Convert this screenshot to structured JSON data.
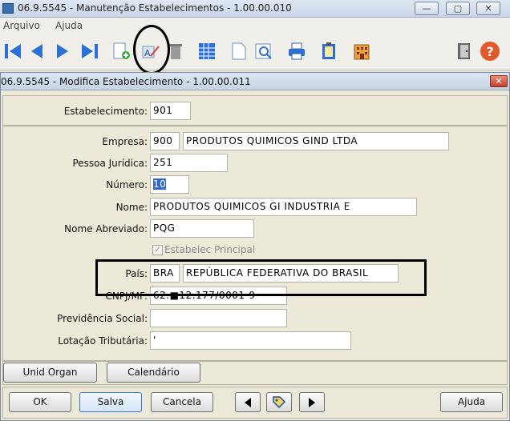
{
  "main_window": {
    "title": "06.9.5545 - Manutenção Estabelecimentos - 1.00.00.010",
    "btn_min": "—",
    "btn_max": "▢",
    "btn_close": "✕"
  },
  "menu": {
    "items": [
      "Arquivo",
      "Ajuda"
    ]
  },
  "toolbar": {
    "icons": [
      "first-icon",
      "previous-icon",
      "next-icon",
      "last-icon",
      "new-icon",
      "edit-icon",
      "delete-icon",
      "calendar-grid-icon",
      "document-icon",
      "preview-icon",
      "print-icon",
      "clipboard-icon",
      "building-icon",
      "exit-door-icon",
      "help-icon"
    ]
  },
  "dialog": {
    "title": "06.9.5545 - Modifica Estabelecimento - 1.00.00.011",
    "close_label": "✕",
    "fields": {
      "estabelecimento": {
        "label": "Estabelecimento:",
        "value": "901"
      },
      "empresa": {
        "label": "Empresa:",
        "code": "900",
        "name": "PRODUTOS QUIMICOS GIND LTDA"
      },
      "pessoa_juridica": {
        "label": "Pessoa Jurídica:",
        "value": "251"
      },
      "numero": {
        "label": "Número:",
        "value": "10"
      },
      "nome": {
        "label": "Nome:",
        "value": "PRODUTOS QUIMICOS GI INDUSTRIA E"
      },
      "nome_abreviado": {
        "label": "Nome Abreviado:",
        "value": "PQG"
      },
      "estabelec_principal": {
        "label": "Estabelec Principal",
        "checked": true
      },
      "pais": {
        "label": "País:",
        "code": "BRA",
        "name": "REPÚBLICA FEDERATIVA DO BRASIL"
      },
      "cnpj": {
        "label": "CNPJ/MF:",
        "value": "62.■12.177/0001-9"
      },
      "previdencia_social": {
        "label": "Previdência Social:",
        "value": ""
      },
      "lotacao_tributaria": {
        "label": "Lotação Tributária:",
        "value": "'"
      }
    },
    "buttons": {
      "unid_organ": "Unid Organ",
      "calendario": "Calendário",
      "ok": "OK",
      "salva": "Salva",
      "cancela": "Cancela",
      "ajuda": "Ajuda"
    }
  },
  "colors": {
    "selection": "#3167c6",
    "annotation": "#000000"
  }
}
